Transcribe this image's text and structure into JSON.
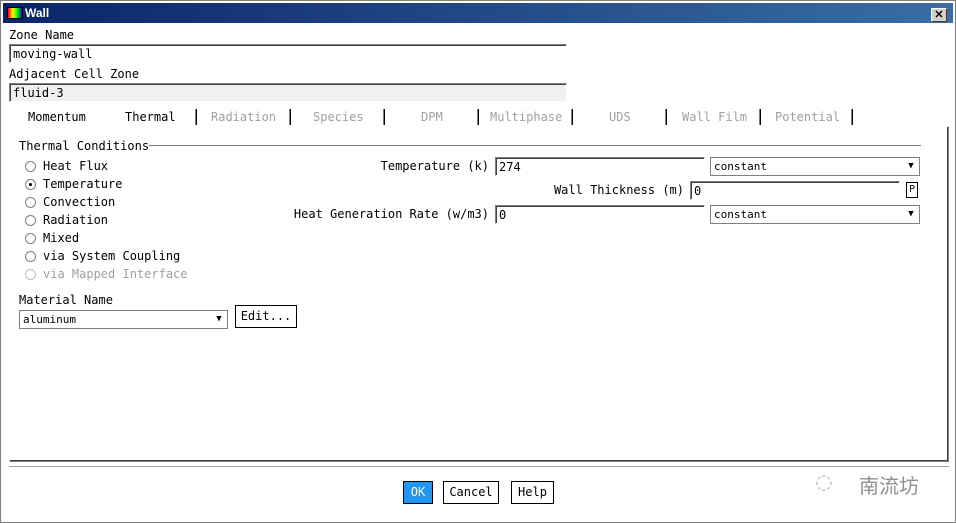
{
  "window": {
    "title": "Wall",
    "close_label": "✕"
  },
  "zone_name": {
    "label": "Zone Name",
    "value": "moving-wall"
  },
  "adjacent_cell_zone": {
    "label": "Adjacent Cell Zone",
    "value": "fluid-3"
  },
  "tabs": [
    {
      "label": "Momentum",
      "enabled": true
    },
    {
      "label": "Thermal",
      "enabled": true,
      "selected": true
    },
    {
      "label": "Radiation",
      "enabled": false
    },
    {
      "label": "Species",
      "enabled": false
    },
    {
      "label": "DPM",
      "enabled": false
    },
    {
      "label": "Multiphase",
      "enabled": false
    },
    {
      "label": "UDS",
      "enabled": false
    },
    {
      "label": "Wall Film",
      "enabled": false
    },
    {
      "label": "Potential",
      "enabled": false
    }
  ],
  "thermal_conditions": {
    "label": "Thermal Conditions",
    "options": [
      {
        "label": "Heat Flux",
        "selected": false
      },
      {
        "label": "Temperature",
        "selected": true
      },
      {
        "label": "Convection",
        "selected": false
      },
      {
        "label": "Radiation",
        "selected": false
      },
      {
        "label": "Mixed",
        "selected": false
      },
      {
        "label": "via System Coupling",
        "selected": false
      },
      {
        "label": "via Mapped Interface",
        "selected": false,
        "enabled": false
      }
    ]
  },
  "material": {
    "label": "Material Name",
    "value": "aluminum",
    "edit_label": "Edit..."
  },
  "temperature": {
    "label": "Temperature (k)",
    "value": "274",
    "method": "constant"
  },
  "wall_thickness": {
    "label": "Wall Thickness (m)",
    "value": "0",
    "p_label": "P"
  },
  "heat_generation": {
    "label": "Heat Generation Rate (w/m3)",
    "value": "0",
    "method": "constant"
  },
  "buttons": {
    "ok": "OK",
    "cancel": "Cancel",
    "help": "Help"
  },
  "watermark": "南流坊",
  "colors": {
    "ok_button": "#2196f3",
    "title_bar": "#0a246a"
  }
}
